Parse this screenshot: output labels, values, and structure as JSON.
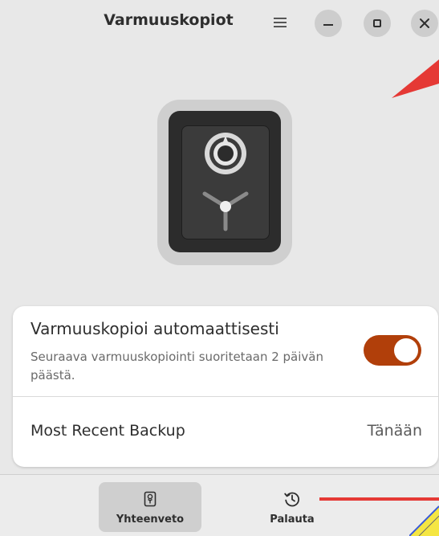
{
  "header": {
    "title": "Varmuuskopiot",
    "menu_icon": "hamburger-icon",
    "window_controls": [
      "minimize-icon",
      "maximize-icon",
      "close-icon"
    ]
  },
  "illustration": {
    "icon": "safe-icon"
  },
  "settings": {
    "auto_backup": {
      "title": "Varmuuskopioi automaattisesti",
      "subtitle": "Seuraava varmuuskopiointi suoritetaan 2 päivän päästä.",
      "enabled": true
    },
    "recent_backup": {
      "label": "Most Recent Backup",
      "value": "Tänään"
    }
  },
  "navigation": {
    "tabs": [
      {
        "label": "Yhteenveto",
        "icon": "safe-small-icon",
        "active": true
      },
      {
        "label": "Palauta",
        "icon": "history-icon",
        "active": false
      }
    ]
  },
  "colors": {
    "accent": "#b13f0a",
    "window_bg": "#e8e8e8",
    "card_bg": "#ffffff",
    "overlay_red": "#e53935",
    "overlay_yellow": "#f5e642"
  }
}
